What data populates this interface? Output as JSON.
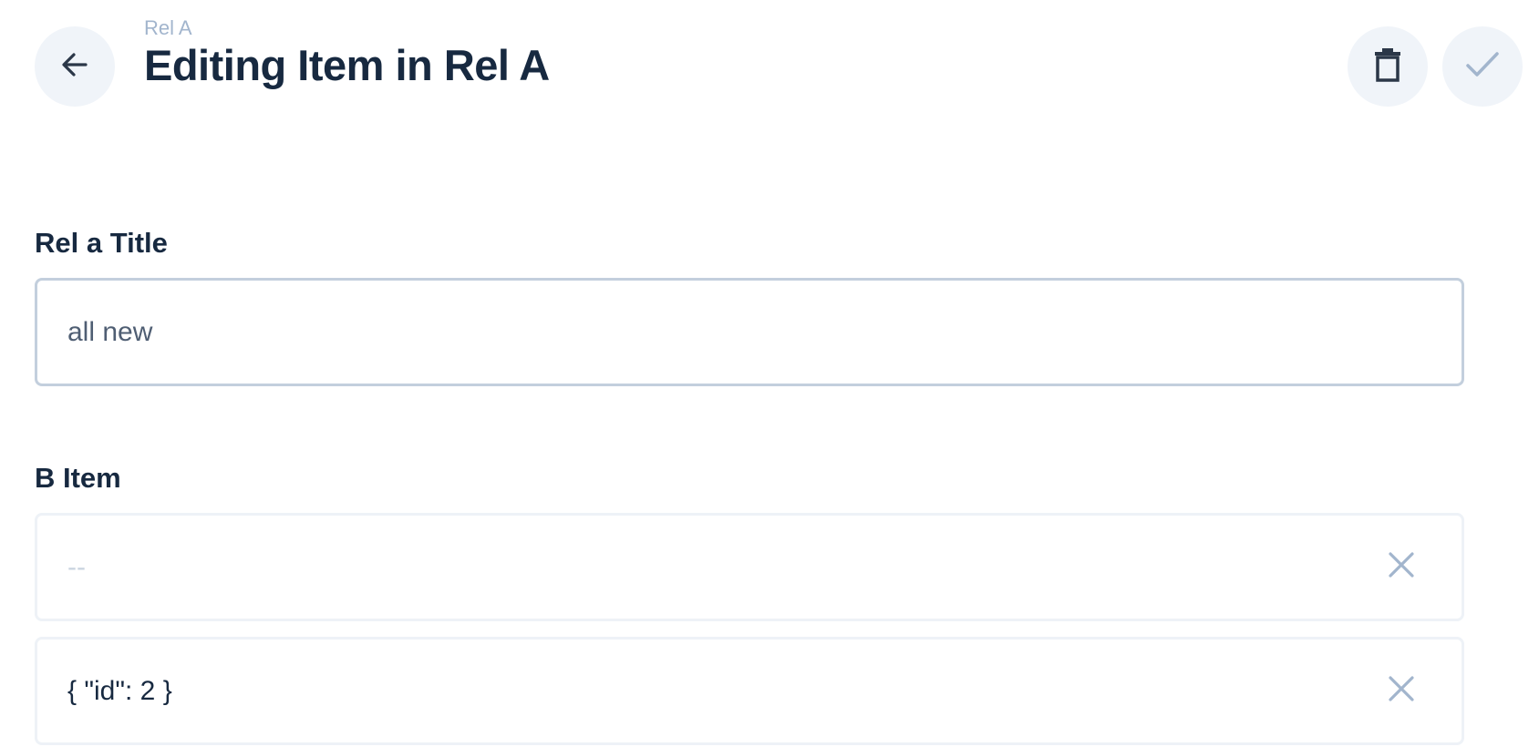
{
  "header": {
    "breadcrumb": "Rel A",
    "title": "Editing Item in Rel A",
    "back_icon": "arrow-left-icon",
    "delete_icon": "trash-icon",
    "save_icon": "check-icon"
  },
  "form": {
    "title_field": {
      "label": "Rel a Title",
      "value": "all new"
    },
    "b_item_field": {
      "label": "B Item",
      "items": [
        {
          "text": "--",
          "placeholder": true,
          "remove_icon": "close-icon"
        },
        {
          "text": "{ \"id\": 2 }",
          "placeholder": false,
          "remove_icon": "close-icon"
        }
      ]
    }
  },
  "colors": {
    "title": "#172940",
    "breadcrumb": "#a2b5cd",
    "button_bg": "#f0f4f9",
    "input_border": "#c3cfdd",
    "icon_muted": "#a2b5cd",
    "icon_dark": "#2b3748"
  }
}
